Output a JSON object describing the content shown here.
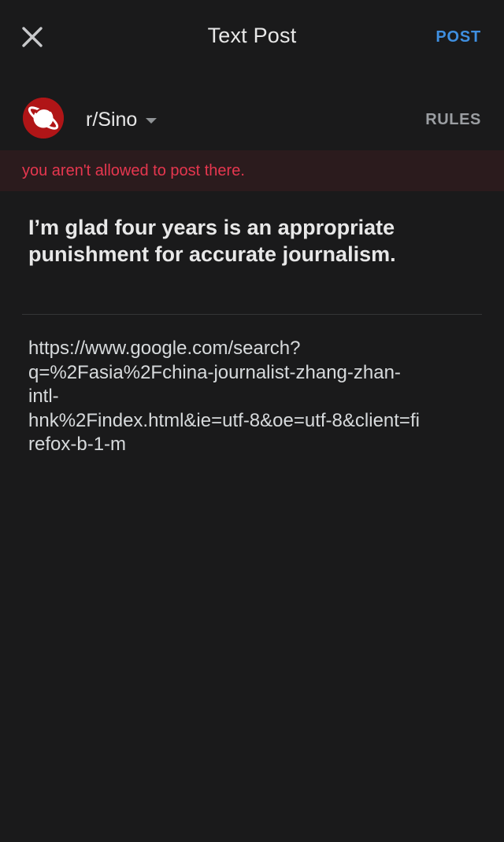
{
  "header": {
    "close_icon": "close-icon",
    "title": "Text Post",
    "post_label": "POST",
    "post_color": "#3f8fe0"
  },
  "community": {
    "avatar_icon": "planet-icon",
    "avatar_color": "#b01517",
    "name": "r/Sino",
    "dropdown_icon": "caret-down-icon",
    "rules_label": "RULES"
  },
  "error": {
    "message": "you aren't allowed to post there.",
    "color": "#e6374f"
  },
  "post": {
    "title": "I’m glad four years is an appropriate punishment for accurate journalism.",
    "body": "https://www.google.com/search?\nq=%2Fasia%2Fchina-journalist-zhang-zhan-\nintl-\nhnk%2Findex.html&ie=utf-8&oe=utf-8&client=fi\nrefox-b-1-m"
  }
}
